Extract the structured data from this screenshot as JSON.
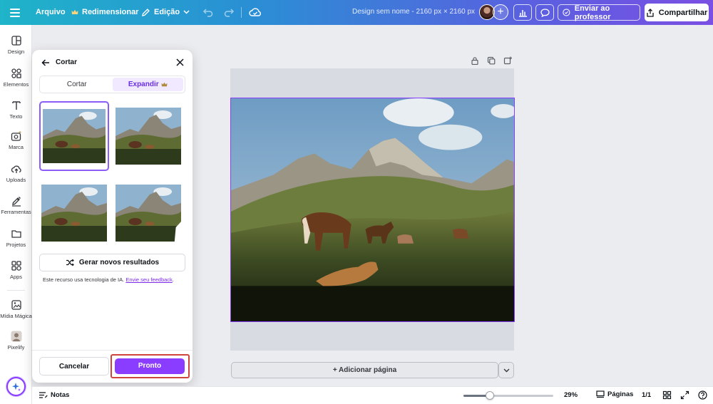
{
  "topbar": {
    "file_label": "Arquivo",
    "resize_label": "Redimensionar",
    "edit_label": "Edição",
    "design_title": "Design sem nome - 2160 px × 2160 px",
    "send_teacher_label": "Enviar ao professor",
    "share_label": "Compartilhar"
  },
  "sidebar": {
    "items": [
      {
        "label": "Design",
        "icon": "design-icon"
      },
      {
        "label": "Elementos",
        "icon": "elements-icon"
      },
      {
        "label": "Texto",
        "icon": "text-icon"
      },
      {
        "label": "Marca",
        "icon": "brand-icon"
      },
      {
        "label": "Uploads",
        "icon": "upload-cloud-icon"
      },
      {
        "label": "Ferramentas",
        "icon": "tools-icon"
      },
      {
        "label": "Projetos",
        "icon": "folder-icon"
      },
      {
        "label": "Apps",
        "icon": "apps-icon"
      },
      {
        "label": "Mídia Mágica",
        "icon": "magic-media-icon"
      },
      {
        "label": "Pixelify",
        "icon": "pixelify-icon"
      }
    ]
  },
  "panel": {
    "title": "Cortar",
    "tabs": {
      "crop": "Cortar",
      "expand": "Expandir"
    },
    "generate_label": "Gerar novos resultados",
    "ai_note": "Este recurso usa tecnologia de IA.",
    "ai_link": "Envie seu feedback",
    "ai_note_end": ".",
    "cancel_label": "Cancelar",
    "done_label": "Pronto"
  },
  "canvas": {
    "add_page_label": "+ Adicionar página"
  },
  "bottombar": {
    "notes_label": "Notas",
    "zoom_value": 29,
    "zoom_label": "29%",
    "pages_label": "Páginas",
    "page_count": "1/1"
  },
  "colors": {
    "accent": "#8b3dff",
    "highlight_border": "#d0443e"
  }
}
